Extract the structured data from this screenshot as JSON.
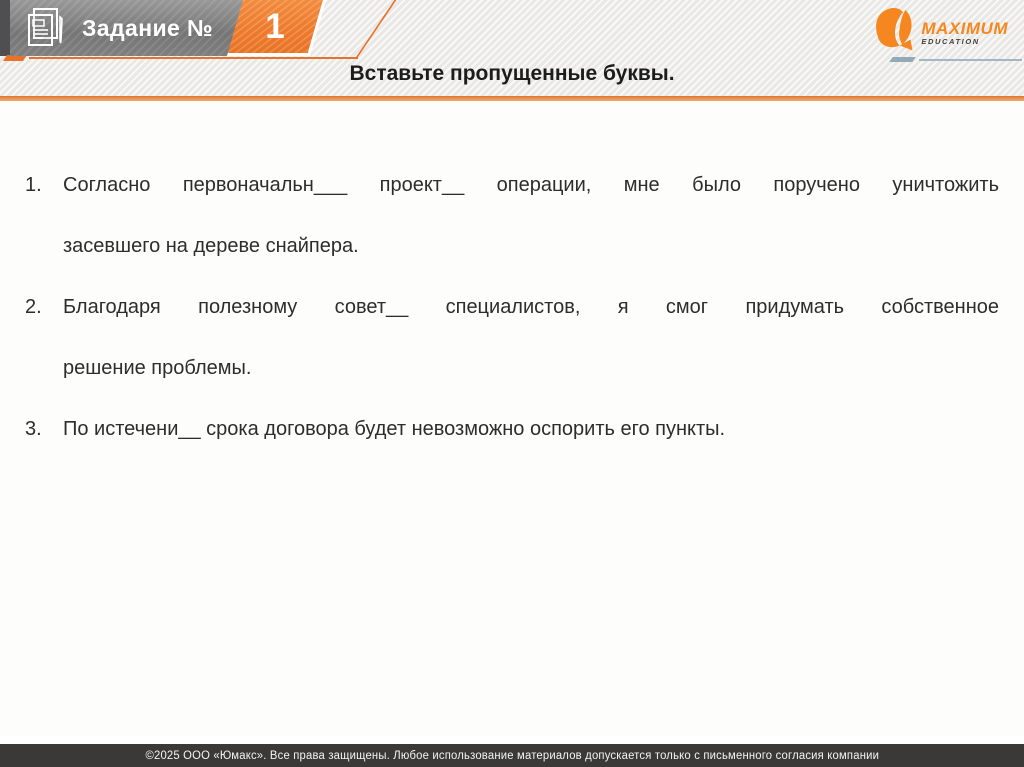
{
  "header": {
    "task_label": "Задание №",
    "task_number": "1",
    "title": "Вставьте пропущенные буквы."
  },
  "logo": {
    "brand": "MAXIMUM",
    "subtitle": "EDUCATION"
  },
  "items": [
    {
      "number": "1.",
      "line1": "Согласно первоначальн___ проект__ операции, мне было поручено уничтожить",
      "line2": "засевшего на дереве снайпера."
    },
    {
      "number": "2.",
      "line1": "Благодаря полезному совет__ специалистов, я смог придумать собственное",
      "line2": "решение проблемы."
    },
    {
      "number": "3.",
      "line1": "По истечени__ срока договора будет невозможно оспорить его пункты."
    }
  ],
  "footer": {
    "copyright": "©2025 ООО «Юмакс». Все права защищены. Любое использование материалов допускается только с письменного согласия компании"
  },
  "icons": {
    "banner_icon": "document-pen-icon",
    "logo_icon": "maximum-hand-icon"
  },
  "colors": {
    "accent_orange": "#E8722A",
    "badge_orange": "#EE7A2C",
    "banner_gray": "#7F7F7F",
    "footer_gray": "#3A3938",
    "logo_orange": "#F6861F",
    "slate_rule": "#92AAB7",
    "text": "#2D2D2D"
  }
}
